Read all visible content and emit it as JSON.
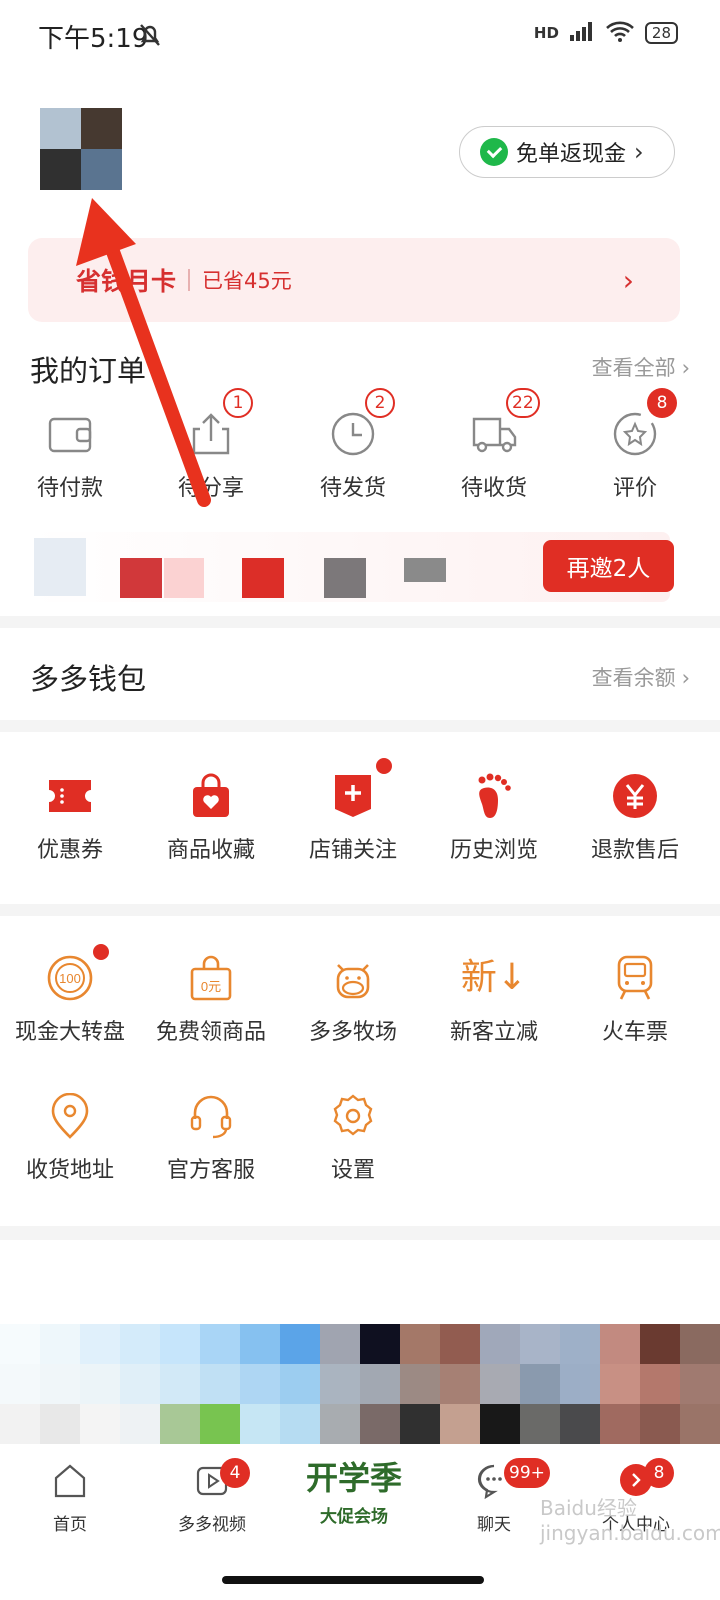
{
  "status_bar": {
    "time": "下午5:19",
    "network": "HD",
    "battery": "28"
  },
  "header": {
    "cash_button": "免单返现金"
  },
  "month_card": {
    "title": "省钱月卡",
    "saved": "已省45元"
  },
  "orders": {
    "title": "我的订单",
    "view_all": "查看全部",
    "items": [
      {
        "label": "待付款",
        "icon": "wallet-icon"
      },
      {
        "label": "待分享",
        "icon": "share-icon",
        "badge": "1"
      },
      {
        "label": "待发货",
        "icon": "clock-icon",
        "badge": "2"
      },
      {
        "label": "待收货",
        "icon": "truck-icon",
        "badge": "22"
      },
      {
        "label": "评价",
        "icon": "review-star-icon",
        "badge": "8"
      }
    ],
    "invite_button": "再邀2人"
  },
  "wallet": {
    "title": "多多钱包",
    "link": "查看余额"
  },
  "services": [
    {
      "label": "优惠券",
      "icon": "coupon-icon"
    },
    {
      "label": "商品收藏",
      "icon": "bag-heart-icon"
    },
    {
      "label": "店铺关注",
      "icon": "store-plus-icon"
    },
    {
      "label": "历史浏览",
      "icon": "footprint-icon"
    },
    {
      "label": "退款售后",
      "icon": "yen-refund-icon"
    }
  ],
  "tools": [
    {
      "label": "现金大转盘",
      "icon": "wheel-100-icon"
    },
    {
      "label": "免费领商品",
      "icon": "free-goods-icon"
    },
    {
      "label": "多多牧场",
      "icon": "cow-icon"
    },
    {
      "label": "新客立减",
      "icon": "new-customer-icon",
      "glyph": "新↓"
    },
    {
      "label": "火车票",
      "icon": "train-icon"
    },
    {
      "label": "收货地址",
      "icon": "location-icon"
    },
    {
      "label": "官方客服",
      "icon": "headset-icon"
    },
    {
      "label": "设置",
      "icon": "settings-gear-icon"
    }
  ],
  "tabbar": {
    "items": [
      {
        "label": "首页",
        "icon": "home-icon"
      },
      {
        "label": "多多视频",
        "icon": "video-icon",
        "badge": "4"
      },
      {
        "label": "大促会场",
        "icon": "promo-icon",
        "promo_text": "开学季"
      },
      {
        "label": "聊天",
        "icon": "chat-icon",
        "badge": "99+"
      },
      {
        "label": "个人中心",
        "icon": "profile-icon",
        "badge": "8"
      }
    ]
  },
  "watermark": "Baidu经验 jingyan.baidu.com",
  "colors": {
    "accent": "#e02e24",
    "orange": "#e8872f",
    "promo_green": "#2e6b2a"
  }
}
